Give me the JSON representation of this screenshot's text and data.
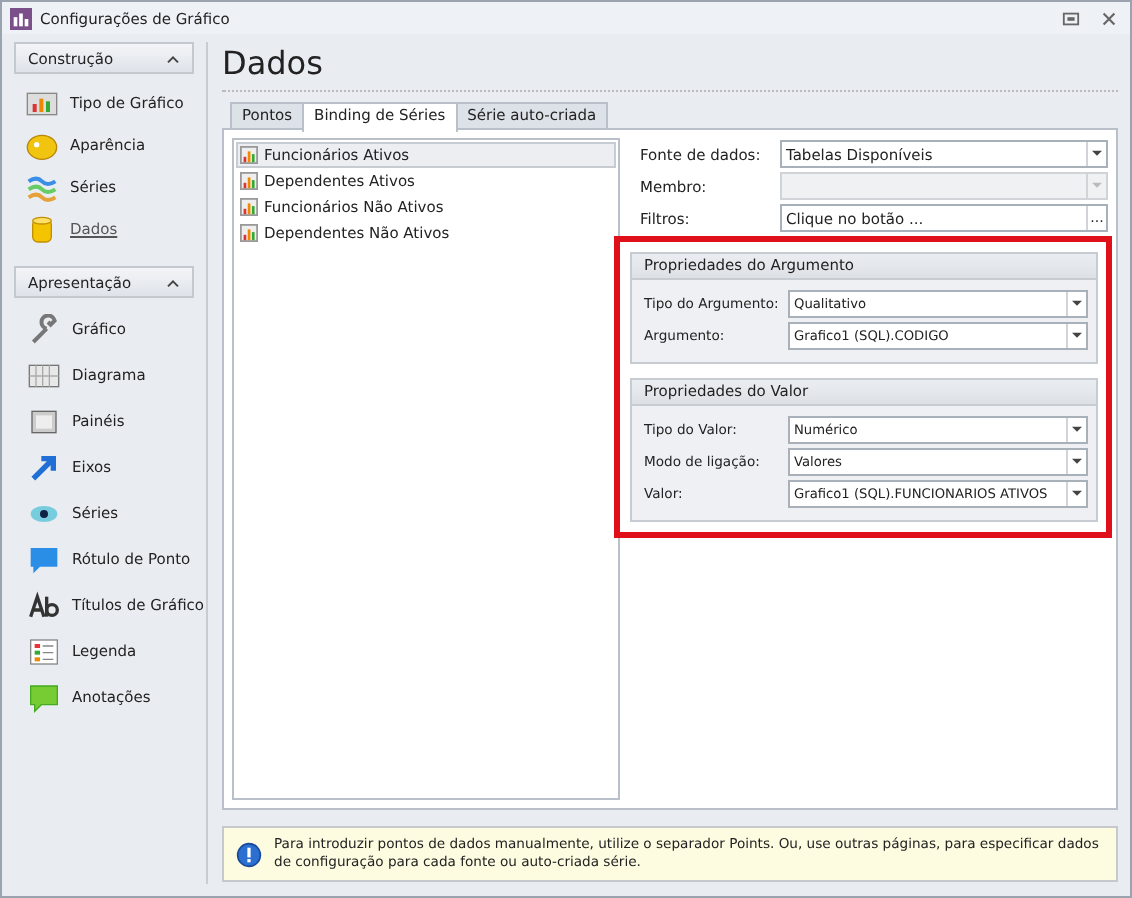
{
  "window": {
    "title": "Configurações de Gráfico"
  },
  "sidebar": {
    "groups": [
      {
        "title": "Construção",
        "expanded": true,
        "items": [
          {
            "label": "Tipo de Gráfico",
            "selected": false
          },
          {
            "label": "Aparência",
            "selected": false
          },
          {
            "label": "Séries",
            "selected": false
          },
          {
            "label": "Dados",
            "selected": true
          }
        ]
      },
      {
        "title": "Apresentação",
        "expanded": true,
        "items": [
          {
            "label": "Gráfico",
            "selected": false
          },
          {
            "label": "Diagrama",
            "selected": false
          },
          {
            "label": "Painéis",
            "selected": false
          },
          {
            "label": "Eixos",
            "selected": false
          },
          {
            "label": "Séries",
            "selected": false
          },
          {
            "label": "Rótulo de Ponto",
            "selected": false
          },
          {
            "label": "Títulos de Gráfico",
            "selected": false
          },
          {
            "label": "Legenda",
            "selected": false
          },
          {
            "label": "Anotações",
            "selected": false
          }
        ]
      }
    ]
  },
  "page_title": "Dados",
  "tabs": [
    {
      "label": "Pontos",
      "selected": false
    },
    {
      "label": "Binding de Séries",
      "selected": true
    },
    {
      "label": "Série auto-criada",
      "selected": false
    }
  ],
  "series": [
    {
      "label": "Funcionários Ativos",
      "selected": true
    },
    {
      "label": "Dependentes Ativos",
      "selected": false
    },
    {
      "label": "Funcionários Não Ativos",
      "selected": false
    },
    {
      "label": "Dependentes Não Ativos",
      "selected": false
    }
  ],
  "fields": [
    {
      "label": "Fonte de dados:",
      "value": "Tabelas Disponíveis",
      "kind": "dropdown",
      "disabled": false
    },
    {
      "label": "Membro:",
      "kind": "dropdown",
      "disabled": true
    },
    {
      "label": "Filtros:",
      "value": "Clique no botão ...",
      "kind": "ellipsis",
      "button": "...",
      "disabled": false
    }
  ],
  "highlight": {
    "marked": true,
    "groups": [
      {
        "title": "Propriedades do Argumento",
        "fields": [
          {
            "label": "Tipo do Argumento:",
            "value": "Qualitativo"
          },
          {
            "label": "Argumento:",
            "value": "Grafico1 (SQL).CODIGO"
          }
        ]
      },
      {
        "title": "Propriedades do Valor",
        "fields": [
          {
            "label": "Tipo do Valor:",
            "value": "Numérico"
          },
          {
            "label": "Modo de ligação:",
            "value": "Valores"
          },
          {
            "label": "Valor:",
            "value": "Grafico1 (SQL).FUNCIONARIOS ATIVOS"
          }
        ]
      }
    ]
  },
  "info": "Para introduzir pontos de dados manualmente, utilize o separador Points. Ou, use outras páginas, para especificar dados de configuração para cada fonte ou auto-criada série."
}
